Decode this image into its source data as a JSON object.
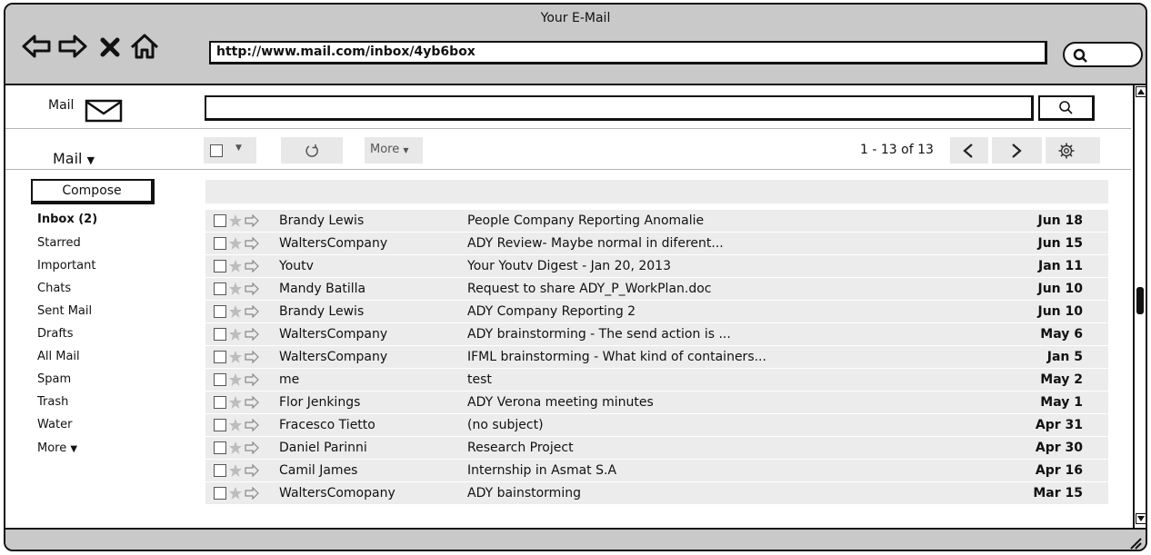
{
  "window": {
    "title": "Your E-Mail",
    "url": "http://www.mail.com/inbox/4yb6box"
  },
  "icons": [
    "back-arrow-icon",
    "forward-arrow-icon",
    "close-x-icon",
    "home-icon",
    "search-icon",
    "mail-envelope-icon",
    "dropdown-arrow-icon",
    "refresh-icon",
    "chevron-left-icon",
    "chevron-right-icon",
    "gear-icon",
    "star-icon",
    "forward-icon",
    "resize-grip-icon"
  ],
  "colors": {
    "chrome": "#c9c9c9",
    "row_bg": "#ececec",
    "button_bg": "#e8e8e8",
    "border": "#111111"
  },
  "search": {
    "mail_label": "Mail"
  },
  "toolbar": {
    "mail_menu": "Mail",
    "more_label": "More",
    "page_info": "1 - 13 of 13"
  },
  "sidebar": {
    "compose": "Compose",
    "folders": [
      "Inbox (2)",
      "Starred",
      "Important",
      "Chats",
      "Sent Mail",
      "Drafts",
      "All Mail",
      "Spam",
      "Trash",
      "Water",
      "More"
    ]
  },
  "emails": [
    {
      "sender": "Brandy Lewis",
      "subject": "People Company Reporting Anomalie",
      "date": "Jun 18"
    },
    {
      "sender": "WaltersCompany",
      "subject": "ADY Review- Maybe normal in diferent...",
      "date": "Jun 15"
    },
    {
      "sender": "Youtv",
      "subject": "Your Youtv Digest - Jan 20, 2013",
      "date": "Jan 11"
    },
    {
      "sender": "Mandy Batilla",
      "subject": "Request to share ADY_P_WorkPlan.doc",
      "date": "Jun 10"
    },
    {
      "sender": "Brandy Lewis",
      "subject": "ADY Company Reporting 2",
      "date": "Jun 10"
    },
    {
      "sender": "WaltersCompany",
      "subject": "ADY brainstorming - The send action is ...",
      "date": "May 6"
    },
    {
      "sender": "WaltersCompany",
      "subject": "IFML brainstorming - What kind of containers...",
      "date": "Jan 5"
    },
    {
      "sender": "me",
      "subject": "test",
      "date": "May 2"
    },
    {
      "sender": "Flor Jenkings",
      "subject": "ADY Verona meeting minutes",
      "date": "May 1"
    },
    {
      "sender": "Fracesco Tietto",
      "subject": "(no subject)",
      "date": "Apr 31"
    },
    {
      "sender": "Daniel Parinni",
      "subject": "Research Project",
      "date": "Apr 30"
    },
    {
      "sender": "Camil James",
      "subject": "Internship in Asmat S.A",
      "date": "Apr 16"
    },
    {
      "sender": "WaltersComopany",
      "subject": "ADY bainstorming",
      "date": "Mar 15"
    }
  ]
}
